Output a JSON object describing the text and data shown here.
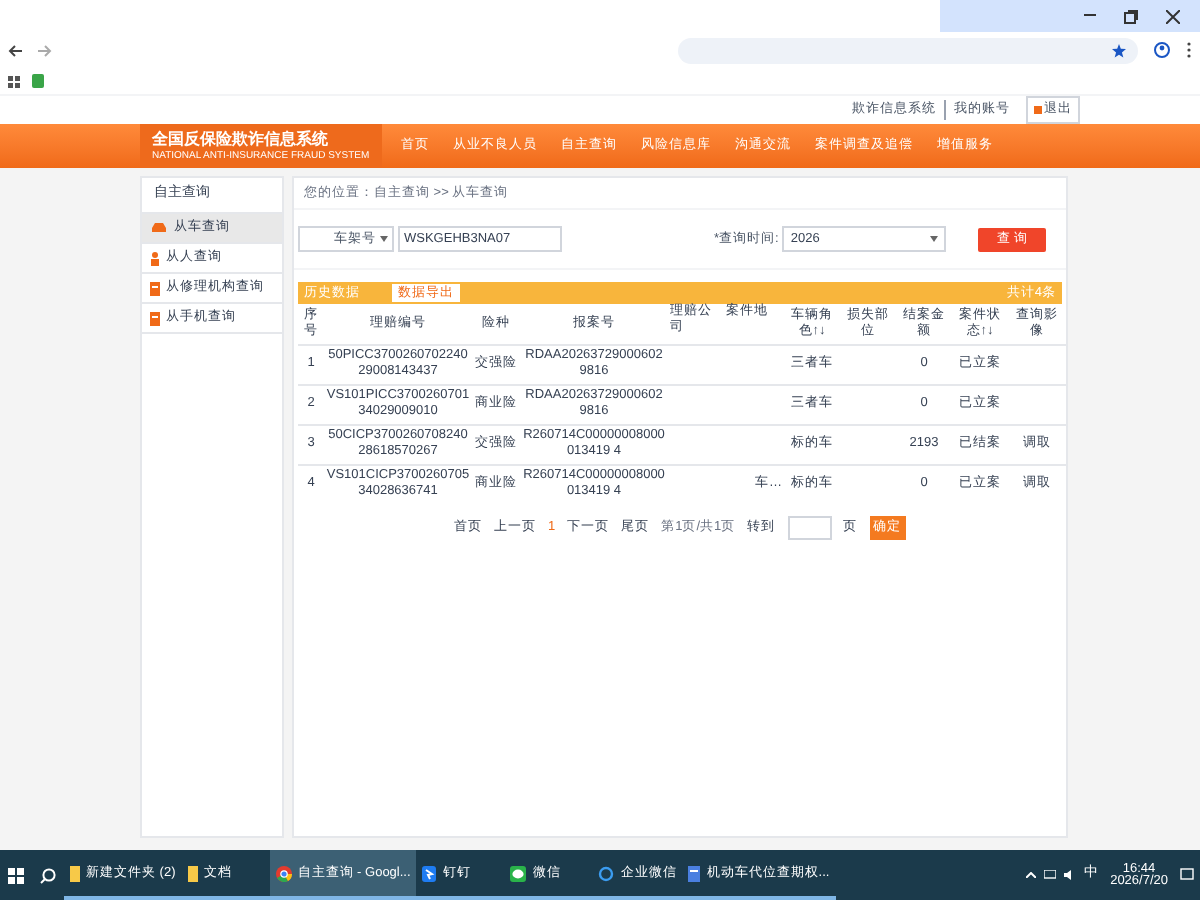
{
  "header_links": [
    {
      "label": "欺诈信息系统",
      "kind": "text"
    },
    {
      "label": "我的账号",
      "kind": "text"
    },
    {
      "label": "退出",
      "kind": "logout"
    }
  ],
  "logo": {
    "title": "全国反保险欺诈信息系统",
    "subtitle": "NATIONAL ANTI-INSURANCE FRAUD SYSTEM"
  },
  "nav": [
    "首页",
    "从业不良人员",
    "自主查询",
    "风险信息库",
    "沟通交流",
    "案件调查及追偿",
    "增值服务"
  ],
  "sidebar": {
    "title": "自主查询",
    "items": [
      {
        "label": "从车查询",
        "kind": "car",
        "selected": true
      },
      {
        "label": "从人查询",
        "kind": "person",
        "selected": false
      },
      {
        "label": "从修理机构查询",
        "kind": "doc",
        "selected": false
      },
      {
        "label": "从手机查询",
        "kind": "doc",
        "selected": false
      }
    ]
  },
  "breadcrumb": "您的位置：自主查询 >> 从车查询",
  "search": {
    "field": "车架号",
    "value": "WSKGEHB3NA07",
    "time_label": "*查询时间:",
    "year": "2026",
    "button": "查 询"
  },
  "results": {
    "tab": "历史数据",
    "export": "数据导出",
    "total": "共计4条",
    "columns": [
      "序号",
      "理赔编号",
      "险种",
      "报案号",
      "理赔公司",
      "案件地",
      "车辆角色↑↓",
      "损失部位",
      "结案金额",
      "案件状态↑↓",
      "查询影像"
    ],
    "rows": [
      [
        "1",
        "50PICC370026070224029008143437",
        "交强险",
        "RDAA202637290006029816",
        "",
        "",
        "三者车",
        "",
        "0",
        "已立案",
        ""
      ],
      [
        "2",
        "VS101PICC370026070134029009010",
        "商业险",
        "RDAA202637290006029816",
        "",
        "",
        "三者车",
        "",
        "0",
        "已立案",
        ""
      ],
      [
        "3",
        "50CICP370026070824028618570267",
        "交强险",
        "R260714C00000008000013419 4",
        "",
        "",
        "标的车",
        "",
        "2193",
        "已结案",
        "调取"
      ],
      [
        "4",
        "VS101CICP370026070534028636741",
        "商业险",
        "R260714C00000008000013419 4",
        "",
        "车…",
        "标的车",
        "",
        "0",
        "已立案",
        "调取"
      ]
    ]
  },
  "pagination": {
    "first": "首页",
    "prev": "上一页",
    "page": "1",
    "next": "下一页",
    "last": "尾页",
    "info": "第1页/共1页",
    "goto": "转到",
    "unit": "页",
    "button": "确定"
  },
  "taskbar": {
    "items": [
      {
        "label": "新建文件夹 (2)",
        "kind": "folder",
        "selected": false
      },
      {
        "label": "文档",
        "kind": "folder",
        "selected": false
      },
      {
        "label": "自主查询 - Googl...",
        "kind": "chrome",
        "selected": true
      },
      {
        "label": "钉钉",
        "kind": "ding",
        "selected": false
      },
      {
        "label": "微信",
        "kind": "wechat",
        "selected": false
      },
      {
        "label": "企业微信",
        "kind": "wecom",
        "selected": false
      },
      {
        "label": "机动车代位查期权...",
        "kind": "doc",
        "selected": false
      }
    ],
    "ime": "中",
    "time": "16:44",
    "date": "2026/7/20"
  }
}
